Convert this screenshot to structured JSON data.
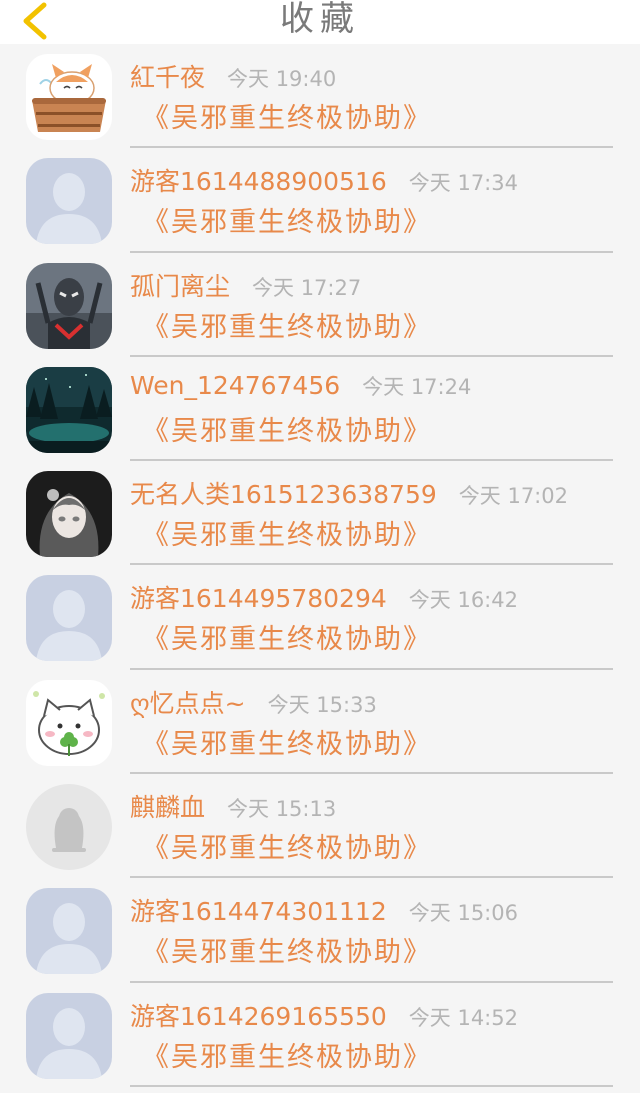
{
  "header": {
    "title": "收藏",
    "back_icon": "chevron-left-icon",
    "back_color": "#f2c200"
  },
  "colors": {
    "accent": "#e8894a",
    "muted": "#b4b4b4",
    "divider": "#c9c9c9"
  },
  "items": [
    {
      "name": "紅千夜",
      "time": "今天 19:40",
      "book": "《吴邪重生终极协助》",
      "avatar": "cat-in-tub-avatar"
    },
    {
      "name": "游客1614488900516",
      "time": "今天 17:34",
      "book": "《吴邪重生终极协助》",
      "avatar": "default-user-avatar"
    },
    {
      "name": "孤门离尘",
      "time": "今天 17:27",
      "book": "《吴邪重生终极协助》",
      "avatar": "armored-hero-avatar"
    },
    {
      "name": "Wen_124767456",
      "time": "今天 17:24",
      "book": "《吴邪重生终极协助》",
      "avatar": "night-forest-avatar"
    },
    {
      "name": "无名人类1615123638759",
      "time": "今天 17:02",
      "book": "《吴邪重生终极协助》",
      "avatar": "anime-girl-avatar"
    },
    {
      "name": "游客1614495780294",
      "time": "今天 16:42",
      "book": "《吴邪重生终极协助》",
      "avatar": "default-user-avatar"
    },
    {
      "name": "ღ忆点点~",
      "time": "今天 15:33",
      "book": "《吴邪重生终极协助》",
      "avatar": "cute-cat-clover-avatar"
    },
    {
      "name": "麒麟血",
      "time": "今天 15:13",
      "book": "《吴邪重生终极协助》",
      "avatar": "penguin-default-avatar"
    },
    {
      "name": "游客1614474301112",
      "time": "今天 15:06",
      "book": "《吴邪重生终极协助》",
      "avatar": "default-user-avatar"
    },
    {
      "name": "游客1614269165550",
      "time": "今天 14:52",
      "book": "《吴邪重生终极协助》",
      "avatar": "default-user-avatar"
    }
  ]
}
